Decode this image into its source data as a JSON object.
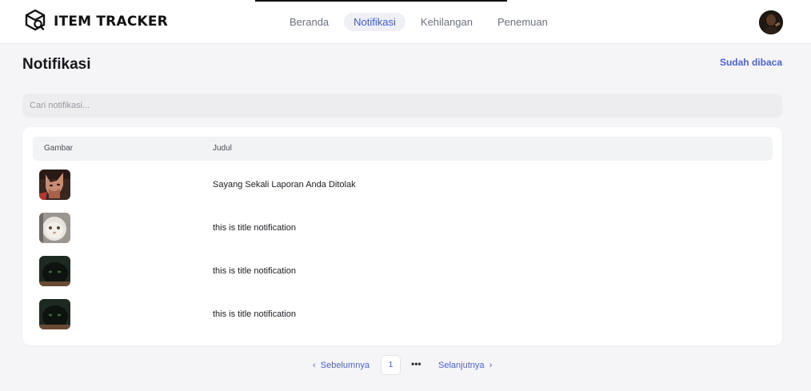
{
  "brand": {
    "name": "ITEM TRACKER",
    "logo_icon": "box-search-icon"
  },
  "nav": {
    "items": [
      {
        "label": "Beranda",
        "active": false
      },
      {
        "label": "Notifikasi",
        "active": true
      },
      {
        "label": "Kehilangan",
        "active": false
      },
      {
        "label": "Penemuan",
        "active": false
      }
    ]
  },
  "user": {
    "avatar_icon": "user-avatar"
  },
  "page": {
    "title": "Notifikasi",
    "mark_read_label": "Sudah dibaca"
  },
  "search": {
    "placeholder": "Cari notifikasi..."
  },
  "table": {
    "headers": [
      "Gambar",
      "Judul"
    ],
    "rows": [
      {
        "image": "cat-sphynx-thumbnail",
        "title": "Sayang Sekali Laporan Anda Ditolak"
      },
      {
        "image": "cat-white-persian-thumbnail",
        "title": "this is title notification"
      },
      {
        "image": "cat-black-thumbnail",
        "title": "this is title notification"
      },
      {
        "image": "cat-black-thumbnail",
        "title": "this is title notification"
      }
    ]
  },
  "pagination": {
    "prev_label": "Sebelumnya",
    "current_page": "1",
    "ellipsis": "•••",
    "next_label": "Selanjutnya"
  },
  "colors": {
    "accent": "#4b63d9",
    "active_nav_bg": "#eef0f6",
    "page_bg": "#f5f5f7"
  }
}
